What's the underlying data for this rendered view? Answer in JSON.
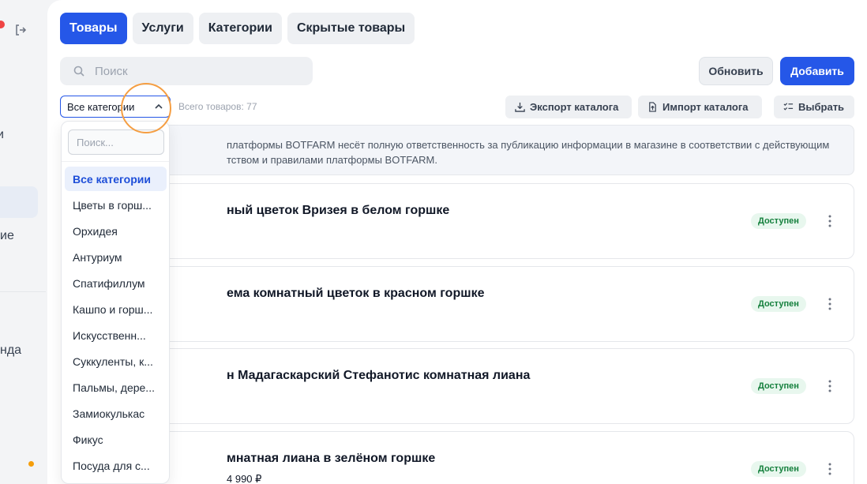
{
  "sidebar": {
    "fragments": [
      "и",
      "ие",
      "нда"
    ]
  },
  "tabs": [
    {
      "label": "Товары",
      "active": true
    },
    {
      "label": "Услуги",
      "active": false
    },
    {
      "label": "Категории",
      "active": false
    },
    {
      "label": "Скрытые товары",
      "active": false
    }
  ],
  "search": {
    "placeholder": "Поиск"
  },
  "toolbar": {
    "refresh_label": "Обновить",
    "add_label": "Добавить",
    "category_select": "Все категории",
    "total": "Всего товаров: 77",
    "export_label": "Экспорт каталога",
    "import_label": "Импорт каталога",
    "select_label": "Выбрать"
  },
  "notice": {
    "line1": "платформы BOTFARM несёт полную ответственность за публикацию информации в магазине в соответствии с действующим",
    "line2": "тством и правилами платформы BOTFARM."
  },
  "products": [
    {
      "title": "ный цветок Вризея в белом горшке",
      "status": "Доступен"
    },
    {
      "title": "ема комнатный цветок в красном горшке",
      "status": "Доступен"
    },
    {
      "title": "н Мадагаскарский Стефанотис комнатная лиана",
      "status": "Доступен"
    },
    {
      "title": "мнатная лиана в зелёном горшке",
      "status": "Доступен"
    }
  ],
  "last_price": "4 990 ₽",
  "dropdown": {
    "search_placeholder": "Поиск...",
    "items": [
      "Все категории",
      "Цветы в горш...",
      "Орхидея",
      "Антуриум",
      "Спатифиллум",
      "Кашпо и горш...",
      "Искусственн...",
      "Суккуленты, к...",
      "Пальмы, дере...",
      "Замиокулькас",
      "Фикус",
      "Посуда для с..."
    ]
  },
  "colors": {
    "accent": "#2557e8",
    "status_green": "#15803d",
    "highlight": "#f59e42"
  }
}
